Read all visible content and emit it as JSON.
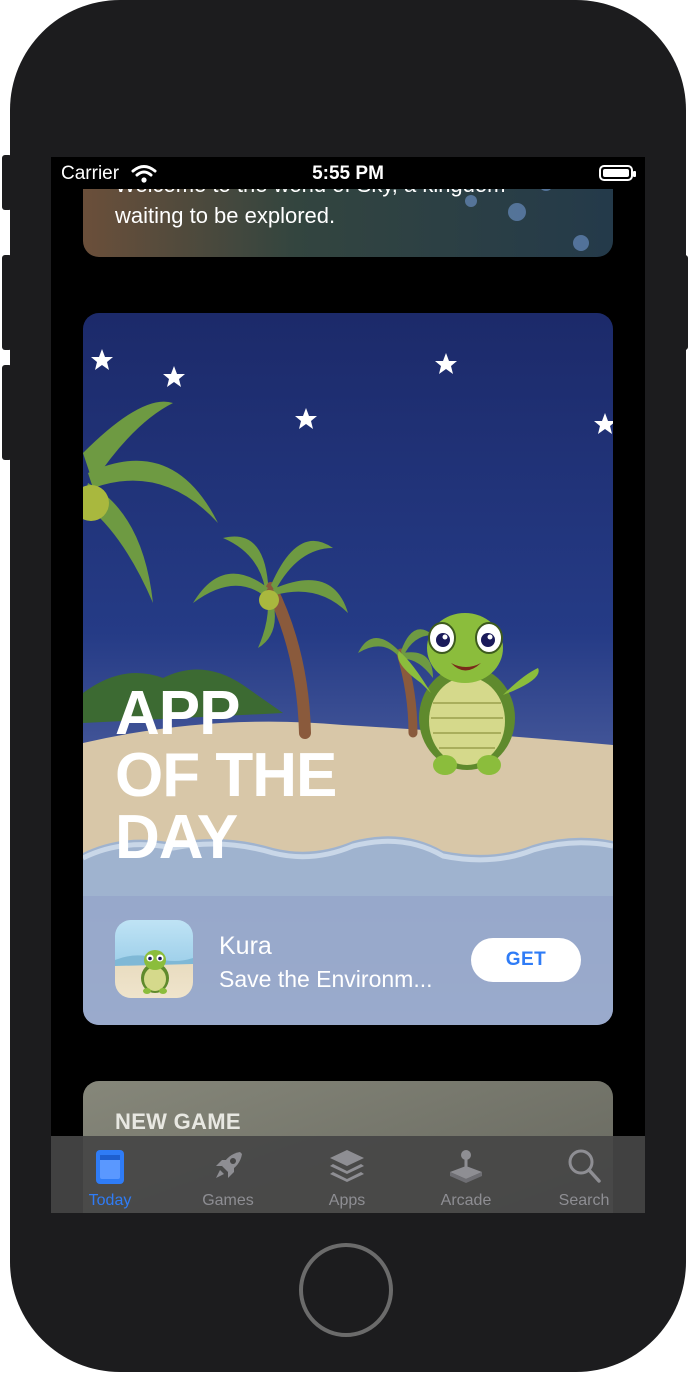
{
  "status_bar": {
    "carrier": "Carrier",
    "time": "5:55 PM",
    "wifi_icon": "wifi-icon",
    "battery_icon": "battery-icon"
  },
  "cards": {
    "top_card": {
      "text": "Welcome to the world of Sky, a kingdom waiting to be explored."
    },
    "app_of_the_day": {
      "title_lines": [
        "APP",
        "OF THE",
        "DAY"
      ],
      "app_name": "Kura",
      "app_subtitle": "Save the Environm...",
      "get_label": "GET"
    },
    "next_card": {
      "label": "NEW GAME"
    }
  },
  "tab_bar": {
    "tabs": [
      {
        "label": "Today",
        "icon": "today-icon",
        "active": true
      },
      {
        "label": "Games",
        "icon": "rocket-icon",
        "active": false
      },
      {
        "label": "Apps",
        "icon": "layers-icon",
        "active": false
      },
      {
        "label": "Arcade",
        "icon": "joystick-icon",
        "active": false
      },
      {
        "label": "Search",
        "icon": "search-icon",
        "active": false
      }
    ]
  },
  "colors": {
    "accent": "#2f7cf6",
    "inactive_tab": "#8e8e93",
    "device": "#1c1c1e"
  }
}
